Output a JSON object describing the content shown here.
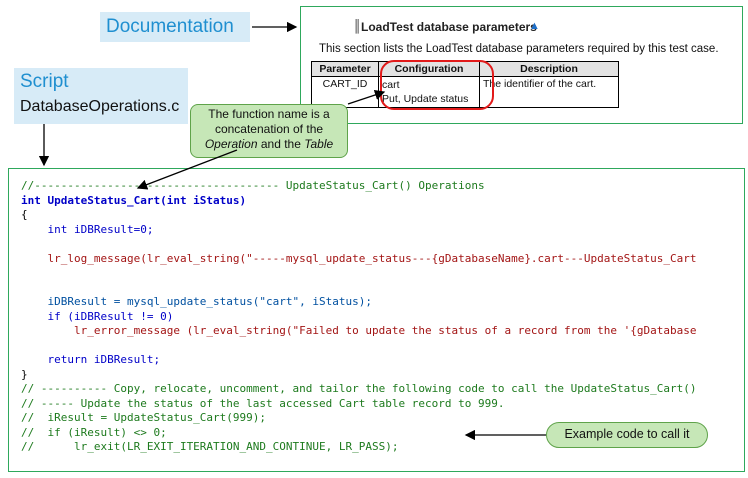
{
  "labels": {
    "documentation": "Documentation",
    "script_title": "Script",
    "script_file": "DatabaseOperations.c"
  },
  "doc_panel": {
    "title": "LoadTest database parameters",
    "description": "This section lists the LoadTest database parameters required by this test case.",
    "table": {
      "headers": [
        "Parameter",
        "Configuration",
        "Description"
      ],
      "row": {
        "parameter": "CART_ID",
        "configuration": [
          "cart",
          "Put, Update status"
        ],
        "description": "The identifier of the cart."
      }
    }
  },
  "callout": {
    "line1": "The function name is a",
    "line2": "concatenation of the",
    "italic1": "Operation",
    "connector": " and the ",
    "italic2": "Table"
  },
  "code": [
    "//------------------------------------- UpdateStatus_Cart() Operations",
    "int UpdateStatus_Cart(int iStatus)",
    "{",
    "    int iDBResult=0;",
    "",
    "    lr_log_message(lr_eval_string(\"-----mysql_update_status---{gDatabaseName}.cart---UpdateStatus_Cart",
    "",
    "",
    "    iDBResult = mysql_update_status(\"cart\", iStatus);",
    "    if (iDBResult != 0)",
    "        lr_error_message (lr_eval_string(\"Failed to update the status of a record from the '{gDatabase",
    "",
    "    return iDBResult;",
    "}",
    "// ---------- Copy, relocate, uncomment, and tailor the following code to call the UpdateStatus_Cart()",
    "// ----- Update the status of the last accessed Cart table record to 999.",
    "//  iResult = UpdateStatus_Cart(999);",
    "//  if (iResult) <> 0;",
    "//      lr_exit(LR_EXIT_ITERATION_AND_CONTINUE, LR_PASS);"
  ],
  "example_label": "Example code to call it",
  "colors": {
    "label_bg": "#d7ebf7",
    "label_text": "#1f8fd0",
    "panel_border": "#2ea85c",
    "callout_bg": "#c6e7b7",
    "highlight": "#e21a1a",
    "comment": "#1d7a1d",
    "keyword": "#0000c8",
    "string": "#a31515"
  }
}
